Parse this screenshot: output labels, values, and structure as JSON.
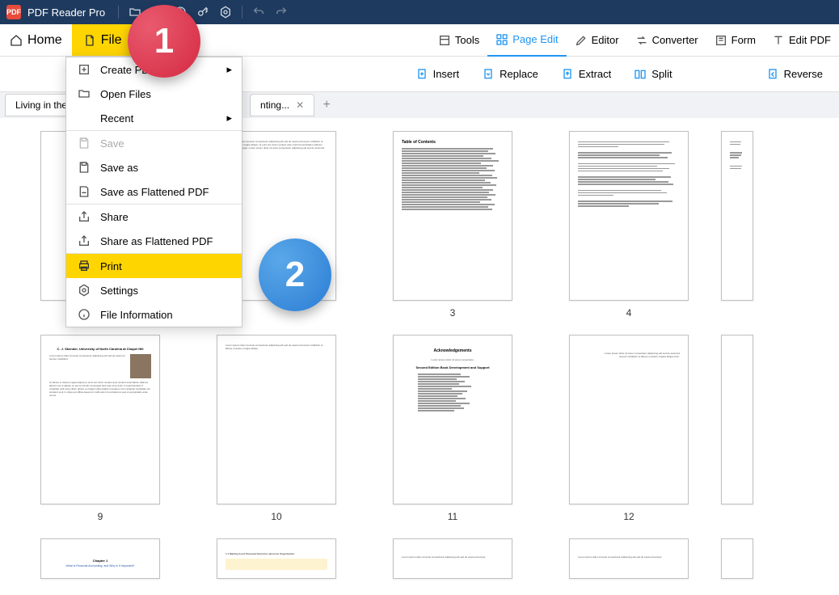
{
  "app": {
    "title": "PDF Reader Pro"
  },
  "toolbar": {
    "home": "Home",
    "file": "File"
  },
  "tools": {
    "tools": "Tools",
    "page_edit": "Page Edit",
    "editor": "Editor",
    "converter": "Converter",
    "form": "Form",
    "edit_pdf": "Edit PDF"
  },
  "subtools": {
    "insert": "Insert",
    "replace": "Replace",
    "extract": "Extract",
    "split": "Split",
    "reverse": "Reverse"
  },
  "tabs": {
    "tab1": "Living in the",
    "tab2": "nting...",
    "close": "✕",
    "add": "+"
  },
  "menu": {
    "create": "Create PDF",
    "open": "Open Files",
    "recent": "Recent",
    "save": "Save",
    "save_as": "Save as",
    "save_flat": "Save as Flattened PDF",
    "share": "Share",
    "share_flat": "Share as Flattened PDF",
    "print": "Print",
    "settings": "Settings",
    "fileinfo": "File Information"
  },
  "callouts": {
    "one": "1",
    "two": "2"
  },
  "pages": {
    "row1": [
      "",
      "",
      "3",
      "4",
      ""
    ],
    "row2": [
      "9",
      "10",
      "11",
      "12",
      ""
    ],
    "row3": [
      "",
      "",
      "",
      "",
      ""
    ]
  },
  "thumb_content": {
    "toc_title": "Table of Contents",
    "ack_title": "Acknowledgements",
    "ack_sub": "Second Edition Book Development and Support",
    "ch1_title": "Chapter 1",
    "ch1_sub": "What Is Financial Accounting, and Why Is It Important?",
    "author_line": "C. J. Skender, University of North Carolina at Chapel Hill"
  }
}
